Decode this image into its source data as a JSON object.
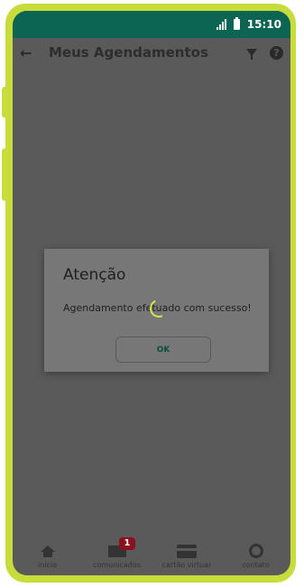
{
  "status_bar": {
    "time": "15:10"
  },
  "header": {
    "title": "Meus Agendamentos",
    "back_icon": "arrow-left-icon",
    "filter_icon": "filter-icon",
    "help_icon": "help-icon"
  },
  "dialog": {
    "title": "Atenção",
    "message": "Agendamento efetuado com sucesso!",
    "ok_label": "OK"
  },
  "bottom_nav": {
    "items": [
      {
        "label": "início",
        "icon": "home-icon"
      },
      {
        "label": "comunicados",
        "icon": "mail-icon",
        "badge": "1"
      },
      {
        "label": "cartão virtual",
        "icon": "card-icon"
      },
      {
        "label": "contato",
        "icon": "headset-icon"
      }
    ]
  },
  "colors": {
    "status_bar": "#0b6552",
    "frame": "#c8dc3c",
    "badge": "#8a1020",
    "spinner": "#d6e64a"
  }
}
